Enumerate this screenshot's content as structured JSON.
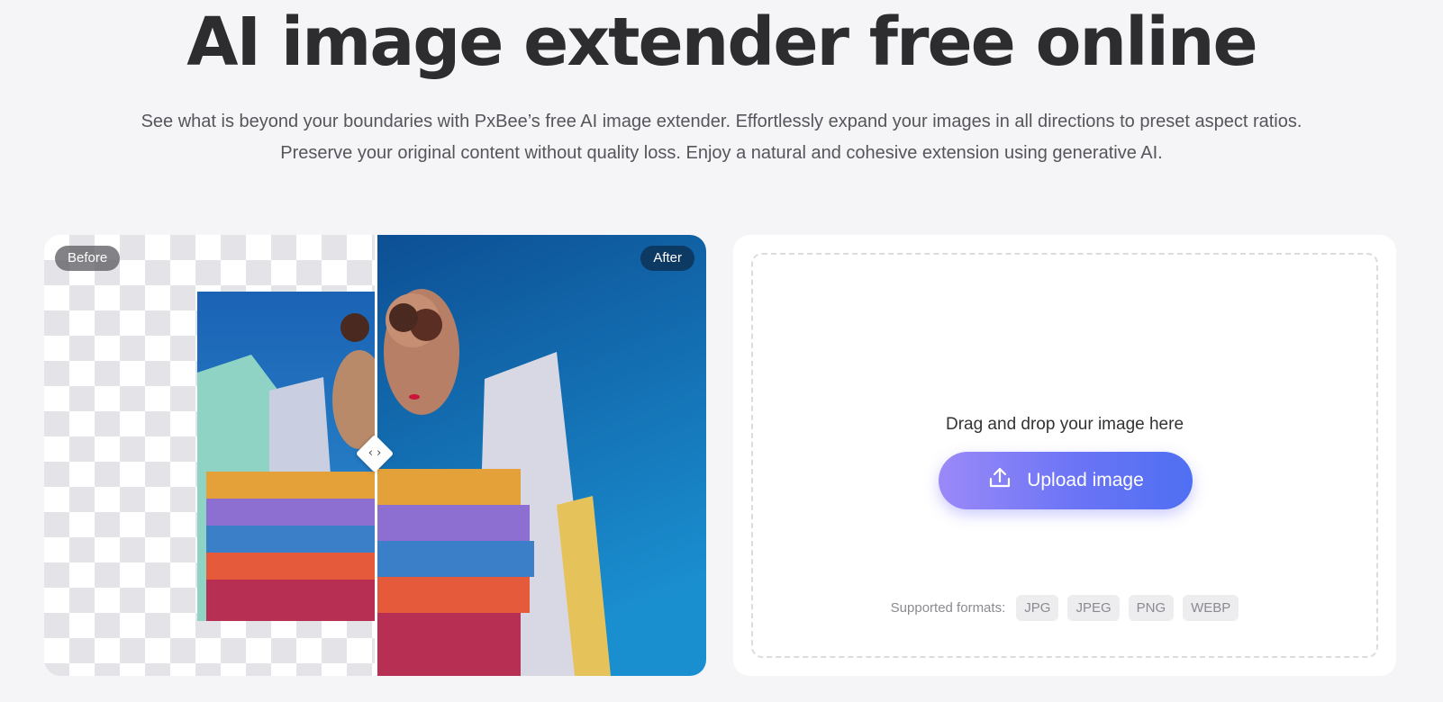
{
  "hero": {
    "title": "AI image extender free online",
    "description": "See what is beyond your boundaries with PxBee’s free AI image extender. Effortlessly expand your images in all directions to preset aspect ratios. Preserve your original content without quality loss. Enjoy a natural and cohesive extension using generative AI."
  },
  "compare": {
    "before_label": "Before",
    "after_label": "After",
    "handle_glyph": "‹ ›"
  },
  "upload": {
    "drop_text": "Drag and drop your image here",
    "button_label": "Upload image",
    "formats_label": "Supported formats:",
    "formats": [
      "JPG",
      "JPEG",
      "PNG",
      "WEBP"
    ]
  },
  "colors": {
    "accent_start": "#9b89f8",
    "accent_end": "#4f6ff2",
    "after_tag": "#0d3a63"
  }
}
